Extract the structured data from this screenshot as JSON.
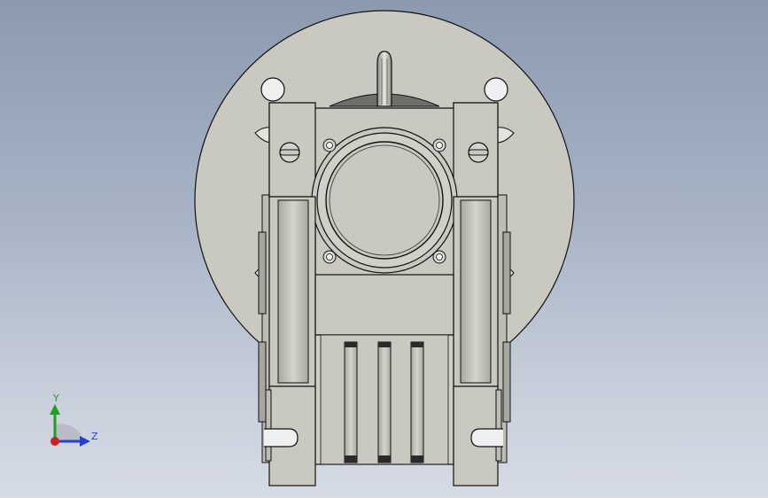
{
  "viewport": {
    "background_top": "#8c9ab0",
    "background_bottom": "#d6dbe4"
  },
  "model": {
    "part_color": "#c9c9c1",
    "edge_color": "#111111",
    "shadow_color": "#8f8f88"
  },
  "triad": {
    "y_label": "Y",
    "z_label": "Z",
    "y_color": "#1fa01f",
    "z_color": "#2244cc",
    "x_color": "#cc2222"
  }
}
